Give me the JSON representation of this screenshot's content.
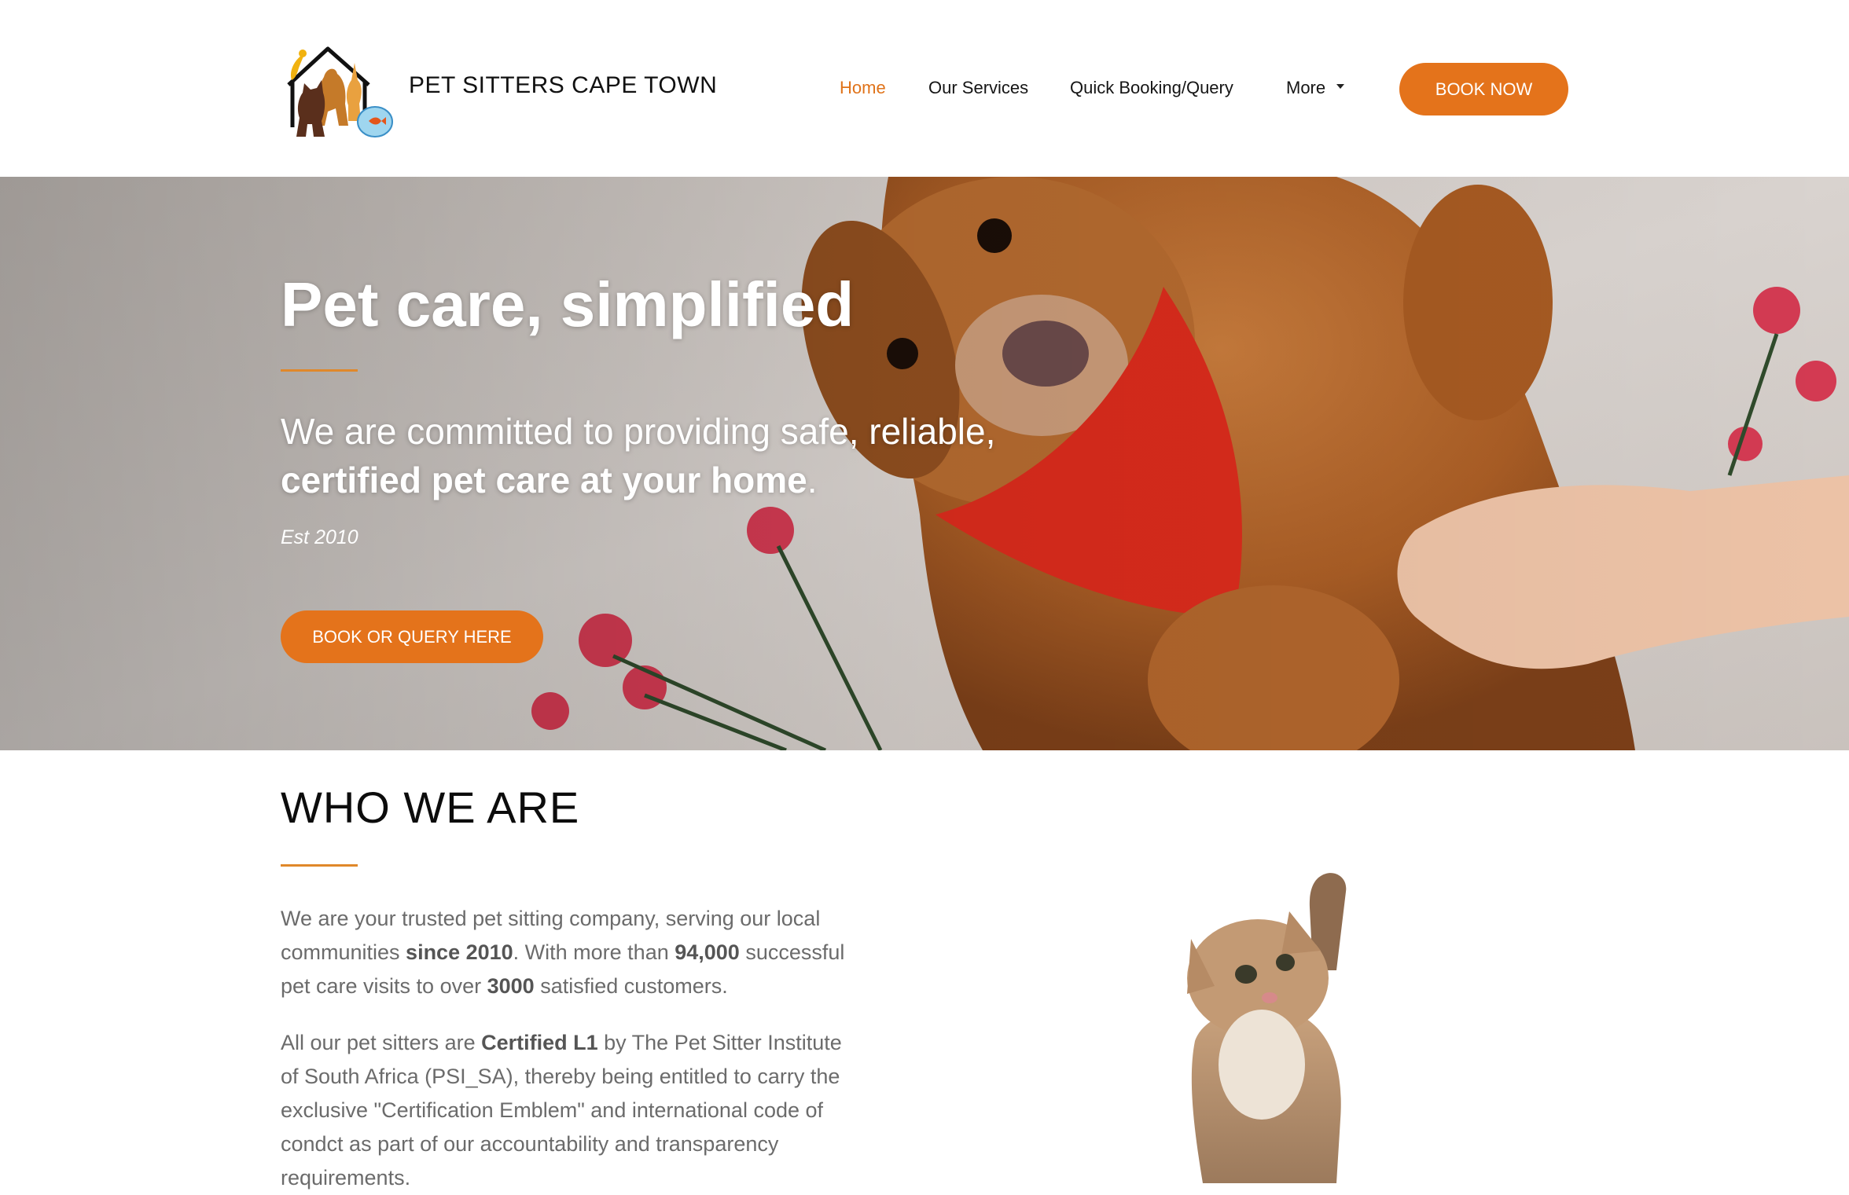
{
  "header": {
    "brand": "PET SITTERS CAPE TOWN",
    "nav": [
      {
        "label": "Home",
        "active": true
      },
      {
        "label": "Our Services"
      },
      {
        "label": "Quick Booking/Query"
      },
      {
        "label": "More"
      }
    ],
    "book_now": "BOOK NOW",
    "logo_icon": "pet-house-logo-icon",
    "dropdown_icon": "caret-down-icon"
  },
  "hero": {
    "title": "Pet care, simplified",
    "subtitle_plain": "We are committed to providing safe, reliable, ",
    "subtitle_bold": "certified pet care at your home",
    "subtitle_end": ".",
    "est": "Est 2010",
    "cta": "BOOK OR QUERY HERE"
  },
  "who": {
    "title": "WHO WE ARE",
    "p1": [
      "We are your trusted pet sitting company, serving our local communities ",
      "since 2010",
      ". With more than ",
      "94,000",
      " successful pet care visits to over ",
      "3000",
      " satisfied customers."
    ],
    "p2": [
      "All our pet sitters are ",
      "Certified L1",
      " by The Pet Sitter Institute of South Africa (PSI_SA), thereby being entitled to carry the exclusive \"Certification Emblem\" and international code of condct as part of our accountability and transparency requirements."
    ]
  },
  "colors": {
    "accent": "#e4731b",
    "text_muted": "#6b6b6b"
  }
}
